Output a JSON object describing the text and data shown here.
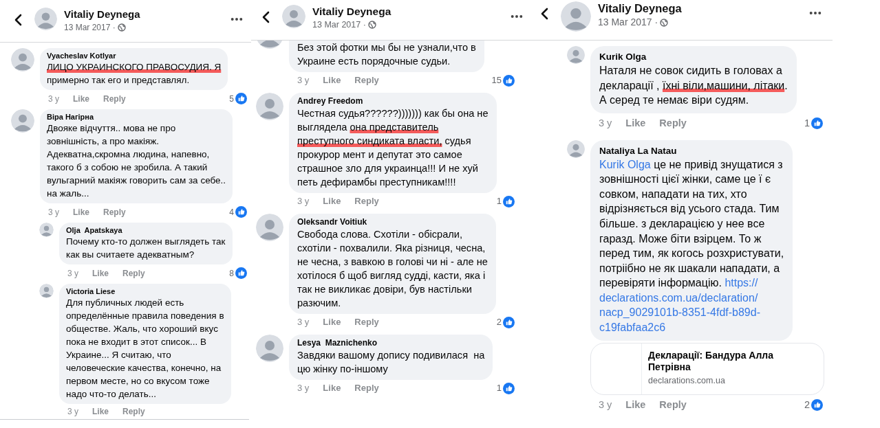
{
  "panels": [
    {
      "header": {
        "author": "Vitaliy Deynega",
        "date": "13 Mar 2017 ·"
      },
      "comments": [
        {
          "kind": "comment",
          "author": "Vyacheslav Kotlyar",
          "parts": [
            {
              "text": "ЛИЦО УКРАИНСКОГО ПРАВОСУДИЯ. Я",
              "marked": true
            },
            {
              "text": "\nпримерно так его и представлял.",
              "marked": false
            }
          ],
          "time": "3 y",
          "like": "Like",
          "reply": "Reply",
          "reactions": "5"
        },
        {
          "kind": "comment",
          "author": "Віра Нагірна",
          "parts": [
            {
              "text": "Двояке відчуття.. мова не про\nзовнішність, а про макіяж.\nАдекватна,скромна людина, напевно,\nтакого б з собою не зробила. А такий\nвульгарний макіяж говорить сам за себе..\nна жаль...",
              "marked": false
            }
          ],
          "time": "3 y",
          "like": "Like",
          "reply": "Reply",
          "reactions": "4"
        },
        {
          "kind": "reply",
          "author": "Olja  Apatskaya",
          "parts": [
            {
              "text": "Почему кто-то должен выглядеть так\nкак вы считаете адекватным?",
              "marked": false
            }
          ],
          "time": "3 y",
          "like": "Like",
          "reply": "Reply",
          "reactions": "8"
        },
        {
          "kind": "reply",
          "author": "Victoria Liese",
          "parts": [
            {
              "text": "Для публичных людей есть\nопределённые правила поведения в\nобществе. Жаль, что хороший вкус\nпока не входит в этот список... В\nУкраине... Я считаю, что\nчеловеческие качества, конечно, на\nпервом месте, но со вкусом тоже\nнадо что-то делать...",
              "marked": false
            }
          ],
          "time": "3 y",
          "like": "Like",
          "reply": "Reply"
        }
      ]
    },
    {
      "header": {
        "author": "Vitaliy Deynega",
        "date": "13 Mar 2017 ·"
      },
      "comments": [
        {
          "kind": "cut",
          "parts": [
            {
              "text": "Без этой фотки мы бы не узнали,что в\nУкраине есть порядочные судьи.",
              "marked": false
            }
          ],
          "time": "3 y",
          "like": "Like",
          "reply": "Reply",
          "reactions": "15"
        },
        {
          "kind": "comment",
          "author": "Andrey Freedom",
          "parts": [
            {
              "text": "Честная судья??????))))))) как бы она не\nвыглядела ",
              "marked": false
            },
            {
              "text": "она представитель\nпреступного синдиката власти,",
              "marked": true
            },
            {
              "text": " судья\nпрокурор мент и депутат это самое\nстрашное зло для украинца!!! И не хуй\nпеть дефирамбы преступникам!!!!",
              "marked": false
            }
          ],
          "time": "3 y",
          "like": "Like",
          "reply": "Reply",
          "reactions": "1"
        },
        {
          "kind": "comment",
          "author": "Oleksandr Voitiuk",
          "parts": [
            {
              "text": "Свобода слова. Схотіли - обісрали,\nсхотіли - похвалили. Яка різниця, чесна,\nне чесна, з вавкою в голові чи ні - але не\nхотілося б щоб вигляд судді, касти, яка і\nтак не викликає довіри, був настільки\nразючим.",
              "marked": false
            }
          ],
          "time": "3 y",
          "like": "Like",
          "reply": "Reply",
          "reactions": "2"
        },
        {
          "kind": "comment",
          "author": "Lesya  Maznichenko",
          "parts": [
            {
              "text": "Завдяки вашому допису подивилася  на\nцю жінку по-іншому",
              "marked": false
            }
          ],
          "time": "3 y",
          "like": "Like",
          "reply": "Reply",
          "reactions": "1"
        }
      ]
    },
    {
      "header": {
        "author": "Vitaliy Deynega",
        "date": "13 Mar 2017 ·"
      },
      "comments": [
        {
          "kind": "reply",
          "author": "Kurik Olga",
          "parts": [
            {
              "text": "Наталя не совок сидить в головах а\nдекларації , ",
              "marked": false
            },
            {
              "text": "їхні віли,машини, літаки",
              "marked": true
            },
            {
              "text": ".\nА серед те немає віри судям.",
              "marked": false
            }
          ],
          "time": "3 y",
          "like": "Like",
          "reply": "Reply",
          "reactions": "1"
        },
        {
          "kind": "reply",
          "author": "Nataliya La Natau",
          "parts": [
            {
              "kind": "mention",
              "text": "Kurik Olga",
              "marked": false
            },
            {
              "text": " це не привід знущатися з\nзовнішності цієї жінки, саме це ї є\nсовком, нападати на тих, хто\nвідрізняється від усього стада. Тим\nбільше. з декларацією у нее все\nгаразд. Може біти взірцем. То ж\nперед тим, як когось розхристувати,\nпотріібно не як шакали нападати, а\nперевіряти інформацію. ",
              "marked": false
            },
            {
              "kind": "link",
              "lines": [
                "https://",
                "declarations.com.ua/declaration/",
                "nacp_9029101b-8351-4fdf-b89d-",
                "c19fabfaa2c6"
              ],
              "marked": false
            }
          ],
          "link_card": {
            "title": "Декларації: Бандура Алла\nПетрівна",
            "domain": "declarations.com.ua"
          },
          "time": "3 y",
          "like": "Like",
          "reply": "Reply",
          "reactions": "2"
        }
      ]
    }
  ]
}
